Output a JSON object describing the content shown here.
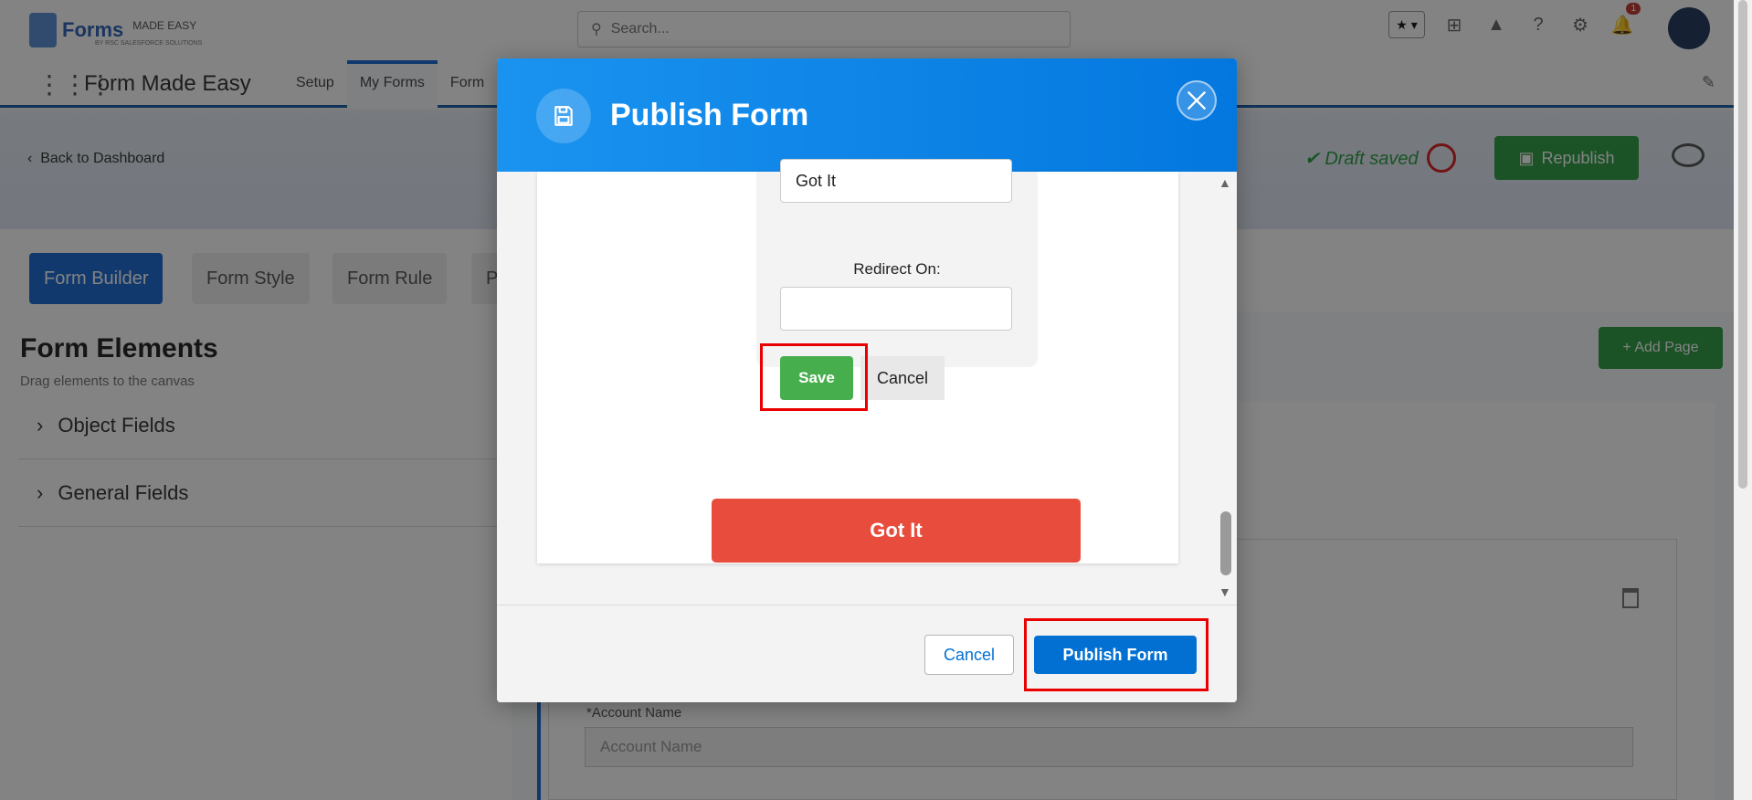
{
  "app": {
    "logo_text": "Forms",
    "logo_sub": "MADE EASY",
    "logo_tag": "BY RSC SALESFORCE SOLUTIONS",
    "search_placeholder": "Search...",
    "notification_count": "1",
    "app_name": "Form Made Easy",
    "nav_items": [
      "Setup",
      "My Forms",
      "Form"
    ]
  },
  "page": {
    "back_link": "Back to Dashboard",
    "draft_status": "✔ Draft saved",
    "republish_label": "Republish",
    "tabs": [
      "Form Builder",
      "Form Style",
      "Form Rule",
      "P"
    ],
    "panel_title": "Form Elements",
    "panel_subtitle": "Drag elements to the canvas",
    "accordion": [
      "Object Fields",
      "General Fields"
    ],
    "add_page_label": "+ Add Page",
    "account_name_label": "*Account Name",
    "account_name_placeholder": "Account Name"
  },
  "modal": {
    "title": "Publish Form",
    "button_text_value": "Got It",
    "redirect_label": "Redirect On:",
    "redirect_value": "",
    "save_label": "Save",
    "cancel_inner_label": "Cancel",
    "got_it_label": "Got It",
    "footer_cancel_label": "Cancel",
    "footer_publish_label": "Publish Form"
  },
  "colors": {
    "modal_header": "#0377de",
    "save_green": "#47ae4e",
    "got_it_red": "#e84c3d",
    "publish_blue": "#0270d2",
    "highlight_red": "#ea0000"
  }
}
